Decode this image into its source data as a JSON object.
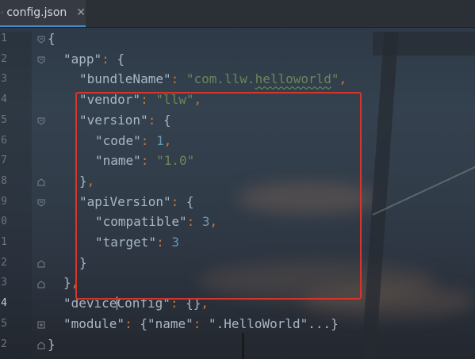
{
  "tab": {
    "filename": "config.json",
    "close_symbol": "✕",
    "icon": "json-file-icon"
  },
  "colors": {
    "key": "#a9b7c6",
    "punctuation": "#cc7832",
    "string": "#6a8759",
    "number": "#6897bb",
    "highlight_box": "#d6352c",
    "tab_underline": "#4a88c7"
  },
  "gutter": {
    "line_numbers": [
      "1",
      "2",
      "3",
      "4",
      "5",
      "6",
      "7",
      "8",
      "9",
      "0",
      "1",
      "2",
      "3",
      "4",
      "5",
      "2"
    ],
    "current_line_index": 13
  },
  "code": {
    "l1_open": "{",
    "l2_key": "\"app\"",
    "l2_colon": ": ",
    "l2_open": "{",
    "l3_key": "\"bundleName\"",
    "l3_colon": ": ",
    "l3_q1": "\"",
    "l3_val_a": "com.llw.",
    "l3_val_b": "helloworld",
    "l3_q2": "\"",
    "l3_comma": ",",
    "l4_key": "\"vendor\"",
    "l4_colon": ": ",
    "l4_val": "\"llw\"",
    "l4_comma": ",",
    "l5_key": "\"version\"",
    "l5_colon": ": ",
    "l5_open": "{",
    "l6_key": "\"code\"",
    "l6_colon": ": ",
    "l6_val": "1",
    "l6_comma": ",",
    "l7_key": "\"name\"",
    "l7_colon": ": ",
    "l7_val": "\"1.0\"",
    "l8_close": "}",
    "l8_comma": ",",
    "l9_key": "\"apiVersion\"",
    "l9_colon": ": ",
    "l9_open": "{",
    "l10_key": "\"compatible\"",
    "l10_colon": ": ",
    "l10_val": "3",
    "l10_comma": ",",
    "l11_key": "\"target\"",
    "l11_colon": ": ",
    "l11_val": "3",
    "l12_close": "}",
    "l13_close": "}",
    "l13_comma": ",",
    "l14_key_a": "\"device",
    "l14_key_b": "Config\"",
    "l14_colon": ": ",
    "l14_val": "{}",
    "l14_comma": ",",
    "l15_key": "\"module\"",
    "l15_colon": ": ",
    "l15_open": "{",
    "l15_inner_key": "\"name\"",
    "l15_inner_colon": ": ",
    "l15_inner_val": "\".HelloWorld\"",
    "l15_ellipsis": "...",
    "l15_close": "}",
    "l16_close": "}"
  }
}
